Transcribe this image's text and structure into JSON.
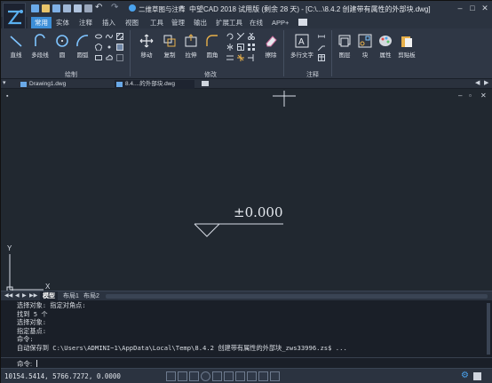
{
  "titlebar": {
    "workspace": "二维草图与注释",
    "title": "中望CAD 2018 试用版 (剩余 28 天) - [C:\\...\\8.4.2  创建带有属性的外部块.dwg]"
  },
  "menu_tabs": [
    "常用",
    "实体",
    "注释",
    "插入",
    "视图",
    "工具",
    "管理",
    "输出",
    "扩展工具",
    "在线",
    "APP+"
  ],
  "ribbon": {
    "draw_tools": [
      "直线",
      "多段线",
      "圆",
      "圆弧"
    ],
    "modify_tools": [
      "移动",
      "复制",
      "拉伸",
      "圆角",
      "擦除"
    ],
    "annotate_tools": [
      "多行文字"
    ],
    "other_tools": [
      "图层",
      "块",
      "属性",
      "剪贴板"
    ],
    "groups": [
      "绘制",
      "修改",
      "注释"
    ]
  },
  "doc_tabs": [
    "Drawing1.dwg",
    "8.4....的外部块.dwg"
  ],
  "drawing": {
    "elevation_text": "±0.000",
    "axis_y": "Y",
    "axis_x": "X"
  },
  "layout_tabs": [
    "模型",
    "布局1",
    "布局2"
  ],
  "command_history": [
    "选择对象: 指定对角点:",
    "找到 5 个",
    "选择对象:",
    "指定基点:",
    "命令:",
    "自动保存到 C:\\Users\\ADMINI~1\\AppData\\Local\\Temp\\8.4.2  创建带有属性的外部块_zws33996.zs$ ..."
  ],
  "command_prompt": "命令:",
  "status": {
    "coordinates": "10154.5414, 5766.7272, 0.0000"
  },
  "colors": {
    "accent": "#3d8fd8",
    "canvas": "#212830"
  }
}
